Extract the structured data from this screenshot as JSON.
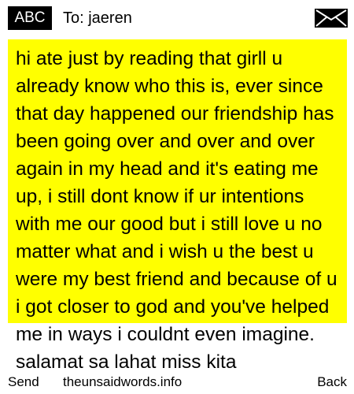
{
  "header": {
    "input_mode": "ABC",
    "to_line": "To: jaeren",
    "icon": "envelope-icon"
  },
  "message": {
    "body": "hi ate just by reading that girll u already know who this is, ever since that day happened our friendship has been going over and over and over again in my head and it's eating me up, i still dont know if ur intentions with me our good but i still love u no matter what and i wish u the best u were my best friend and because of u i got closer to god and you've helped me in ways i couldnt even imagine. salamat sa lahat miss kita",
    "highlight_color": "#ffff00"
  },
  "footer": {
    "left_softkey": "Send",
    "center_text": "theunsaidwords.info",
    "right_softkey": "Back"
  }
}
